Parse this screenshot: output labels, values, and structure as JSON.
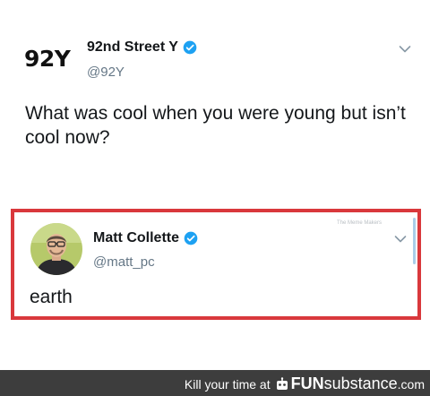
{
  "main_tweet": {
    "logo_text": "92Y",
    "display_name": "92nd Street Y",
    "handle": "@92Y",
    "text": "What was cool when you were young but isn’t cool now?",
    "verified": true
  },
  "reply_tweet": {
    "display_name": "Matt Collette",
    "handle": "@matt_pc",
    "text": "earth",
    "verified": true,
    "watermark": "The Meme Makers"
  },
  "footer": {
    "prefix": "Kill your time at",
    "brand_fun": "FUN",
    "brand_substance": "substance",
    "brand_suffix": ".com"
  },
  "colors": {
    "highlight_border": "#d9383c",
    "verified_badge": "#1da1f2",
    "footer_bg": "#3d3d3d"
  },
  "icons": [
    "verified-badge-icon",
    "chevron-down-icon",
    "robot-icon"
  ]
}
